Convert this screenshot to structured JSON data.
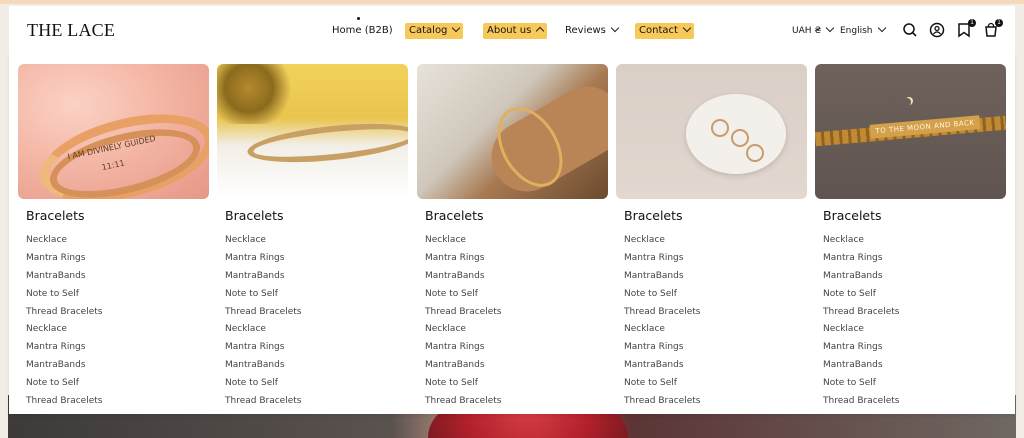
{
  "header": {
    "logo": "THE LACE",
    "nav": [
      {
        "label": "Home (B2B)"
      },
      {
        "label": "Catalog"
      },
      {
        "label": "About us"
      },
      {
        "label": "Reviews"
      },
      {
        "label": "Contact"
      }
    ],
    "currency": "UAH ₴",
    "language": "English",
    "wishlist_count": "1",
    "cart_count": "1"
  },
  "icons": [
    "search-icon",
    "account-icon",
    "wishlist-icon",
    "cart-icon",
    "chevron-down-icon",
    "chevron-up-icon"
  ],
  "colors": {
    "highlight": "#f7c95b",
    "text": "#111111"
  },
  "mega_menu": {
    "columns": [
      {
        "title": "Bracelets",
        "items": [
          "Necklace",
          "Mantra Rings",
          "MantraBands",
          "Note to Self",
          "Thread Bracelets",
          "Necklace",
          "Mantra Rings",
          "MantraBands",
          "Note to Self",
          "Thread Bracelets"
        ]
      },
      {
        "title": "Bracelets",
        "items": [
          "Necklace",
          "Mantra Rings",
          "MantraBands",
          "Note to Self",
          "Thread Bracelets",
          "Necklace",
          "Mantra Rings",
          "MantraBands",
          "Note to Self",
          "Thread Bracelets"
        ]
      },
      {
        "title": "Bracelets",
        "items": [
          "Necklace",
          "Mantra Rings",
          "MantraBands",
          "Note to Self",
          "Thread Bracelets",
          "Necklace",
          "Mantra Rings",
          "MantraBands",
          "Note to Self",
          "Thread Bracelets"
        ]
      },
      {
        "title": "Bracelets",
        "items": [
          "Necklace",
          "Mantra Rings",
          "MantraBands",
          "Note to Self",
          "Thread Bracelets",
          "Necklace",
          "Mantra Rings",
          "MantraBands",
          "Note to Self",
          "Thread Bracelets"
        ]
      },
      {
        "title": "Bracelets",
        "items": [
          "Necklace",
          "Mantra Rings",
          "MantraBands",
          "Note to Self",
          "Thread Bracelets",
          "Necklace",
          "Mantra Rings",
          "MantraBands",
          "Note to Self",
          "Thread Bracelets"
        ]
      }
    ],
    "image_engravings": [
      "I AM DIVINELY GUIDED",
      "11:11",
      "TO THE MOON AND BACK"
    ]
  }
}
